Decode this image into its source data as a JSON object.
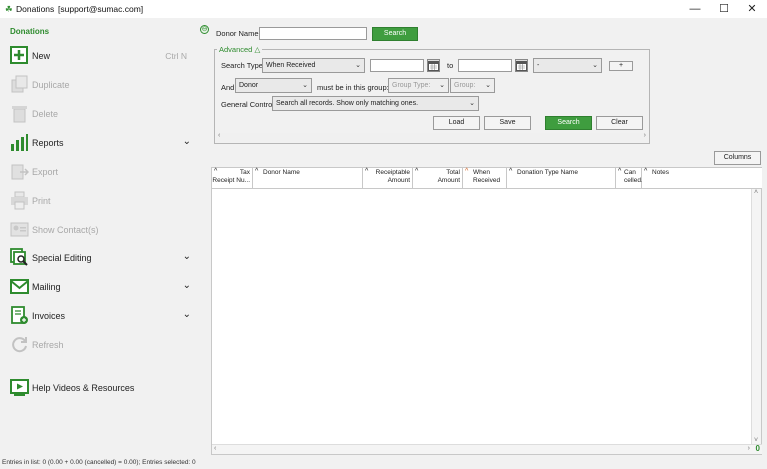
{
  "window": {
    "title": "Donations",
    "user": "[support@sumac.com]",
    "min": "—",
    "max": "☐",
    "close": "✕"
  },
  "sidebar": {
    "heading": "Donations",
    "items": [
      {
        "label": "New",
        "shortcut": "Ctrl N"
      },
      {
        "label": "Duplicate"
      },
      {
        "label": "Delete"
      },
      {
        "label": "Reports"
      },
      {
        "label": "Export"
      },
      {
        "label": "Print"
      },
      {
        "label": "Show Contact(s)"
      },
      {
        "label": "Special Editing"
      },
      {
        "label": "Mailing"
      },
      {
        "label": "Invoices"
      },
      {
        "label": "Refresh"
      },
      {
        "label": "Help Videos & Resources"
      }
    ]
  },
  "search": {
    "donor_name_label": "Donor Name",
    "donor_name_value": "",
    "search_button": "Search",
    "advanced_label": "Advanced △",
    "search_type_label": "Search Type:",
    "search_type_value": "When Received",
    "to_label": "to",
    "range_value": "-",
    "plus_button": "+",
    "and_label": "And",
    "and_value": "Donor",
    "must_be_label": "must be in this group:",
    "group_type": "Group Type:",
    "group": "Group:",
    "general_control_label": "General Control:",
    "general_control_value": "Search all records. Show only matching ones.",
    "load_button": "Load",
    "save_button": "Save",
    "search_button2": "Search",
    "clear_button": "Clear"
  },
  "grid": {
    "columns_button": "Columns",
    "headers": [
      {
        "l1": "Tax",
        "l2": "Receipt Nu..."
      },
      {
        "l1": "Donor Name",
        "l2": ""
      },
      {
        "l1": "Receiptable",
        "l2": "Amount"
      },
      {
        "l1": "Total",
        "l2": "Amount"
      },
      {
        "l1": "When",
        "l2": "Received"
      },
      {
        "l1": "Donation Type Name",
        "l2": ""
      },
      {
        "l1": "Can",
        "l2": "celled..."
      },
      {
        "l1": "Notes",
        "l2": ""
      }
    ],
    "count": "0"
  },
  "status": {
    "text": "Entries in list: 0 (0.00 + 0.00 (cancelled) = 0.00); Entries selected: 0"
  },
  "colors": {
    "accent": "#3f9d3f",
    "disabled": "#a8a8a8"
  }
}
